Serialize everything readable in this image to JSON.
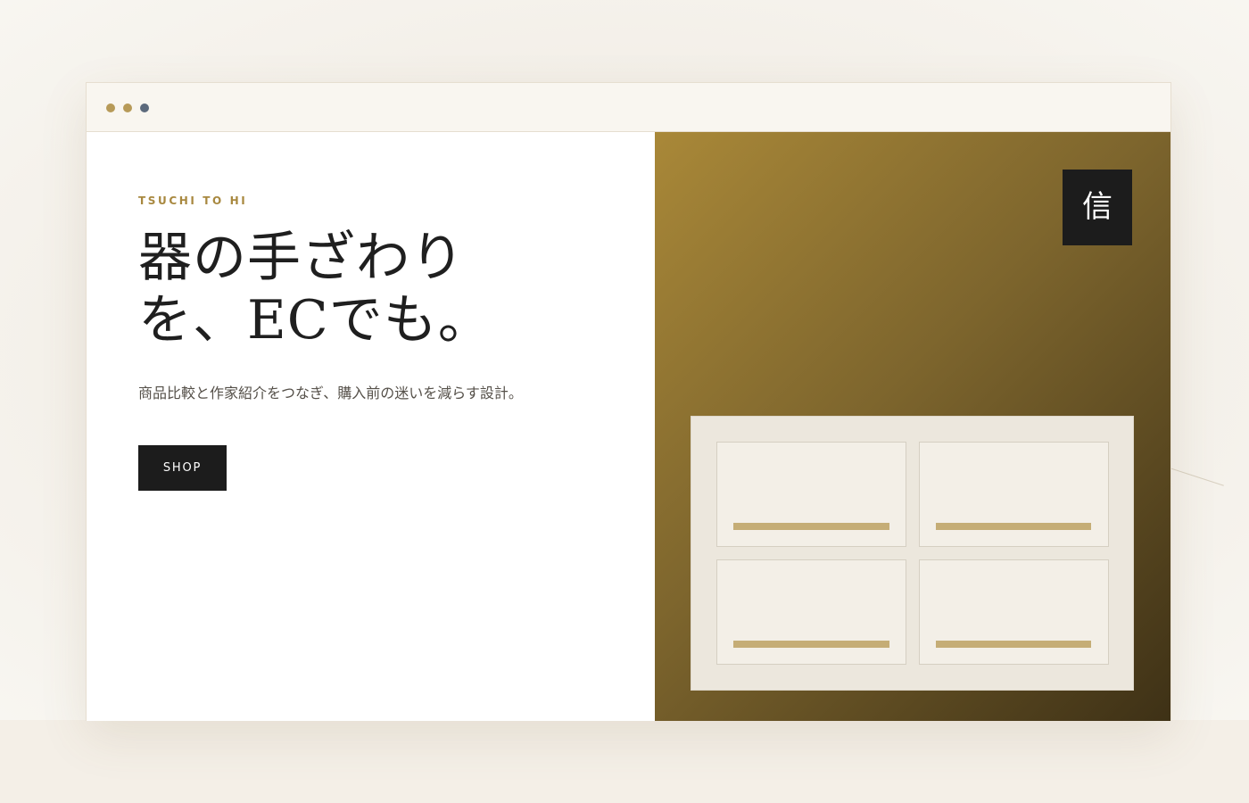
{
  "window": {
    "controls": [
      {
        "name": "window-dot-1",
        "color": "#b79a58"
      },
      {
        "name": "window-dot-2",
        "color": "#b79a58"
      },
      {
        "name": "window-dot-3",
        "color": "#5c6a7c"
      }
    ]
  },
  "hero": {
    "brand": "TSUCHI TO HI",
    "headline_line1": "器の手ざわり",
    "headline_line2": "を、ECでも。",
    "subcopy": "商品比較と作家紹介をつなぎ、購入前の迷いを減らす設計。",
    "cta_label": "SHOP"
  },
  "visual": {
    "badge_glyph": "信",
    "product_cards": 4
  },
  "colors": {
    "accent_gold": "#a8883f",
    "dark": "#1c1c1c",
    "card_bar": "#c5ad76",
    "gradient_start": "#a98838",
    "gradient_end": "#3e3116"
  }
}
